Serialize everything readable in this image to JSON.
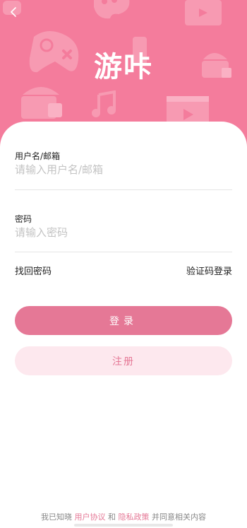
{
  "header": {
    "back_icon": "chevron-left-icon",
    "title": "游咔",
    "background_color": "#f47c9c",
    "decorations": [
      "gamepad-icon",
      "palette-icon",
      "video-icon",
      "music-note-icon",
      "cake-icon",
      "video-player-icon"
    ]
  },
  "form": {
    "username": {
      "label": "用户名/邮箱",
      "placeholder": "请输入用户名/邮箱",
      "value": ""
    },
    "password": {
      "label": "密码",
      "placeholder": "请输入密码",
      "value": ""
    },
    "forgot_password": "找回密码",
    "code_login": "验证码登录"
  },
  "buttons": {
    "login": "登录",
    "register": "注册"
  },
  "agreement": {
    "prefix": "我已知晓",
    "user_agreement": "用户协议",
    "and": "和",
    "privacy_policy": "隐私政策",
    "suffix": "并同意相关内容"
  },
  "colors": {
    "accent": "#e57896",
    "register_bg": "#fde8ee"
  }
}
